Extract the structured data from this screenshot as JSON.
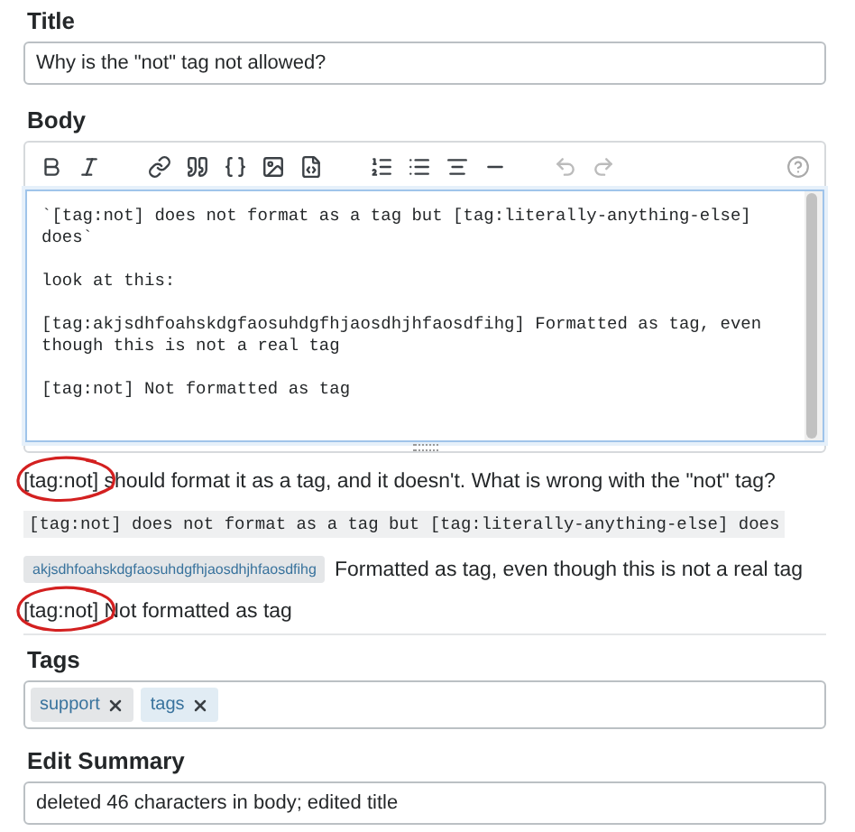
{
  "title_field": {
    "label": "Title",
    "value": "Why is the \"not\" tag not allowed?"
  },
  "body": {
    "label": "Body",
    "editor_lines": [
      "`[tag:not] does not format as a tag but [tag:literally-anything-else] does`",
      "look at this:",
      "[tag:akjsdhfoahskdgfaosuhdgfhjaosdhjhfaosdfihg] Formatted as tag, even though this is not a real tag",
      "[tag:not] Not formatted as tag"
    ],
    "preview": [
      {
        "kind": "text",
        "text": "[tag:not] should format it as a tag, and it doesn't. What is wrong with the \"not\" tag?",
        "circled": true
      },
      {
        "kind": "code",
        "text": "[tag:not] does not format as a tag but [tag:literally-anything-else] does"
      },
      {
        "kind": "tag",
        "tag": "akjsdhfoahskdgfaosuhdgfhjaosdhjhfaosdfihg",
        "text": "Formatted as tag, even though this is not a real tag"
      },
      {
        "kind": "text",
        "text": "[tag:not] Not formatted as tag",
        "circled": true
      }
    ]
  },
  "tags": {
    "label": "Tags",
    "items": [
      {
        "name": "support",
        "color": "#e4e6e8"
      },
      {
        "name": "tags",
        "color": "#e1ecf4"
      }
    ]
  },
  "edit_summary": {
    "label": "Edit Summary",
    "value": "deleted 46 characters in body; edited title"
  }
}
